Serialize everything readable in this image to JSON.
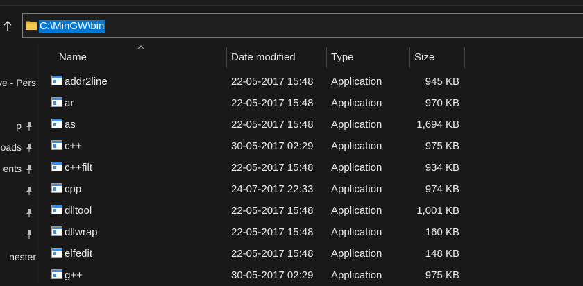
{
  "address": {
    "path": "C:\\MinGW\\bin"
  },
  "sidebar": {
    "items": [
      {
        "label": "ve - Pers",
        "pinned": false
      },
      {
        "label": "p",
        "pinned": true
      },
      {
        "label": "oads",
        "pinned": true
      },
      {
        "label": "ents",
        "pinned": true
      },
      {
        "label": "",
        "pinned": true
      },
      {
        "label": "",
        "pinned": true
      },
      {
        "label": "",
        "pinned": true
      },
      {
        "label": "nester",
        "pinned": false
      }
    ]
  },
  "columns": {
    "name": "Name",
    "date": "Date modified",
    "type": "Type",
    "size": "Size"
  },
  "files": [
    {
      "name": "addr2line",
      "date": "22-05-2017 15:48",
      "type": "Application",
      "size": "945 KB"
    },
    {
      "name": "ar",
      "date": "22-05-2017 15:48",
      "type": "Application",
      "size": "970 KB"
    },
    {
      "name": "as",
      "date": "22-05-2017 15:48",
      "type": "Application",
      "size": "1,694 KB"
    },
    {
      "name": "c++",
      "date": "30-05-2017 02:29",
      "type": "Application",
      "size": "975 KB"
    },
    {
      "name": "c++filt",
      "date": "22-05-2017 15:48",
      "type": "Application",
      "size": "934 KB"
    },
    {
      "name": "cpp",
      "date": "24-07-2017 22:33",
      "type": "Application",
      "size": "974 KB"
    },
    {
      "name": "dlltool",
      "date": "22-05-2017 15:48",
      "type": "Application",
      "size": "1,001 KB"
    },
    {
      "name": "dllwrap",
      "date": "22-05-2017 15:48",
      "type": "Application",
      "size": "160 KB"
    },
    {
      "name": "elfedit",
      "date": "22-05-2017 15:48",
      "type": "Application",
      "size": "148 KB"
    },
    {
      "name": "g++",
      "date": "30-05-2017 02:29",
      "type": "Application",
      "size": "975 KB"
    }
  ],
  "colors": {
    "background": "#191919",
    "selection": "#0078d7",
    "folder": "#e8b73c",
    "icon_blue": "#3c8de0"
  }
}
